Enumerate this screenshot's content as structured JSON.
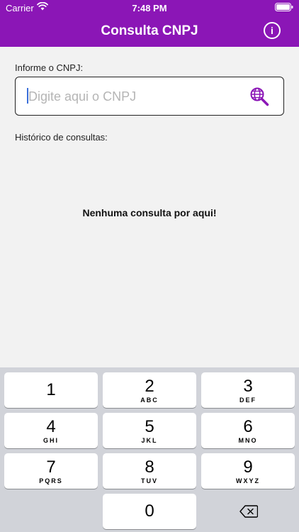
{
  "status_bar": {
    "carrier": "Carrier",
    "time": "7:48 PM",
    "wifi_icon": "wifi-icon",
    "battery_icon": "battery-icon"
  },
  "header": {
    "title": "Consulta CNPJ",
    "info_icon": "info-icon",
    "info_symbol": "i",
    "background_color": "#8b16b6"
  },
  "form": {
    "label": "Informe o CNPJ:",
    "input_value": "",
    "placeholder": "Digite aqui o CNPJ",
    "search_icon": "globe-search-icon",
    "accent_color": "#8b16b6"
  },
  "history": {
    "label": "Histórico de consultas:",
    "empty_message": "Nenhuma consulta por aqui!"
  },
  "keyboard": {
    "keys": [
      {
        "digit": "1",
        "letters": ""
      },
      {
        "digit": "2",
        "letters": "ABC"
      },
      {
        "digit": "3",
        "letters": "DEF"
      },
      {
        "digit": "4",
        "letters": "GHI"
      },
      {
        "digit": "5",
        "letters": "JKL"
      },
      {
        "digit": "6",
        "letters": "MNO"
      },
      {
        "digit": "7",
        "letters": "PQRS"
      },
      {
        "digit": "8",
        "letters": "TUV"
      },
      {
        "digit": "9",
        "letters": "WXYZ"
      },
      {
        "digit": "0",
        "letters": ""
      }
    ],
    "delete_icon": "backspace-icon"
  }
}
